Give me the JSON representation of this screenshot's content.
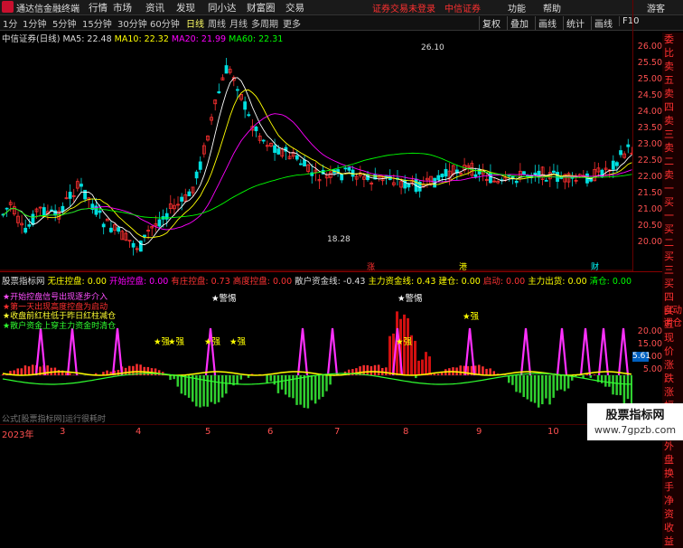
{
  "app": {
    "brand": "通达信金融终端"
  },
  "menu": [
    "行情",
    "市场",
    "资讯",
    "发现",
    "同小达",
    "财富圈",
    "交易"
  ],
  "promo": [
    "证券交易未登录",
    "中信证券"
  ],
  "topright": [
    "功能",
    "帮助",
    "游客"
  ],
  "periods": [
    "1分",
    "1分钟",
    "5分钟",
    "15分钟",
    "30分钟",
    "60分钟",
    "日线",
    "周线",
    "月线",
    "多周期",
    "更多"
  ],
  "toolbar_buttons": [
    "复权",
    "叠加",
    "画线",
    "统计",
    "画线",
    "F10"
  ],
  "ma": {
    "title": "中信证券(日线)",
    "ma5": "MA5: 22.48",
    "ma10": "MA10: 22.32",
    "ma20": "MA20: 21.99",
    "ma60": "MA60: 22.31"
  },
  "price_ticks": [
    "26.00",
    "25.50",
    "25.00",
    "24.50",
    "24.00",
    "23.50",
    "23.00",
    "22.50",
    "22.00",
    "21.50",
    "21.00",
    "20.50",
    "20.00"
  ],
  "annotations": {
    "high": "26.10",
    "low": "18.28",
    "zhang": "涨",
    "gang": "港",
    "cai": "财"
  },
  "right_tabs": [
    "委比",
    "卖五",
    "卖四",
    "卖三",
    "卖二",
    "卖一",
    "买一",
    "买二",
    "买三",
    "买四",
    "买五",
    "现价",
    "涨跌",
    "涨幅",
    "总量",
    "外盘",
    "换手",
    "净资",
    "收益"
  ],
  "indicator": {
    "title": "股票指标网",
    "items": [
      "无庄控盘: 0.00",
      "开始控盘: 0.00",
      "有庄控盘: 0.73",
      "高度控盘: 0.00",
      "散户资金线: -0.43",
      "主力资金线: 0.43",
      "建仓: 0.00",
      "启动: 0.00",
      "主力出货: 0.00",
      "清仓: 0.00"
    ]
  },
  "legend": [
    "★开始控盘信号出现逐步介入",
    "★第一天出现高度控盘为启动",
    "★收盘前红柱低于昨日红柱减仓",
    "★散户资金上穿主力资金时清仓"
  ],
  "ind_ticks": [
    "20.00",
    "15.00",
    "10.00",
    "5.00"
  ],
  "ind_marker": "5.61",
  "ind_labels": {
    "warn1": "★警惕",
    "warn2": "★警惕",
    "strong": "★强"
  },
  "auto": "自动调仓",
  "footer": "公式[股票指标网]运行很耗时",
  "bottom_axis": [
    "2023年",
    "3",
    "4",
    "5",
    "6",
    "7",
    "8",
    "9",
    "10"
  ],
  "watermark": {
    "line1": "股票指标网",
    "line2": "www.7gpzb.com"
  }
}
